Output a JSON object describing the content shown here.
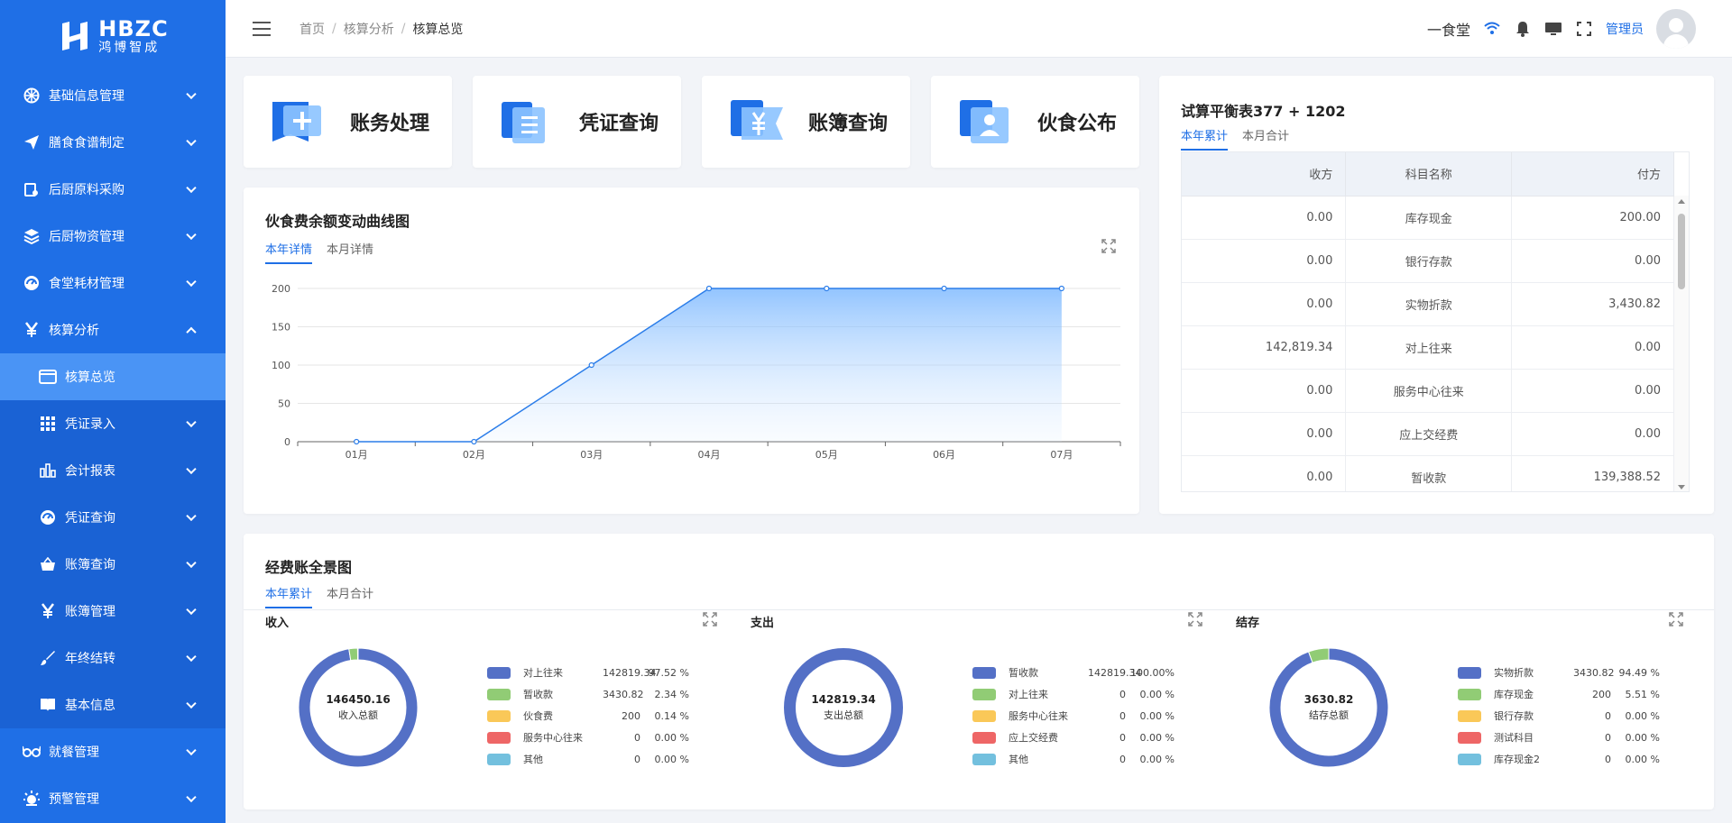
{
  "brand": {
    "name": "HBZC",
    "sub": "鸿博智成"
  },
  "header": {
    "breadcrumb": [
      "首页",
      "核算分析",
      "核算总览"
    ],
    "canteen": "一食堂",
    "admin": "管理员"
  },
  "sidebar": {
    "items": [
      {
        "label": "基础信息管理",
        "icon": "dashboard-icon"
      },
      {
        "label": "膳食食谱制定",
        "icon": "send-icon"
      },
      {
        "label": "后厨原料采购",
        "icon": "purchase-icon"
      },
      {
        "label": "后厨物资管理",
        "icon": "layers-icon"
      },
      {
        "label": "食堂耗材管理",
        "icon": "gauge-icon"
      },
      {
        "label": "核算分析",
        "icon": "yen-icon"
      }
    ],
    "sub_items": [
      {
        "label": "核算总览",
        "icon": "window-icon"
      },
      {
        "label": "凭证录入",
        "icon": "grid-icon"
      },
      {
        "label": "会计报表",
        "icon": "bar-chart-icon"
      },
      {
        "label": "凭证查询",
        "icon": "gauge-icon"
      },
      {
        "label": "账簿查询",
        "icon": "basket-icon"
      },
      {
        "label": "账簿管理",
        "icon": "yen-icon"
      },
      {
        "label": "年终结转",
        "icon": "brush-icon"
      },
      {
        "label": "基本信息",
        "icon": "book-icon"
      }
    ],
    "bottom_items": [
      {
        "label": "就餐管理",
        "icon": "glasses-icon"
      },
      {
        "label": "预警管理",
        "icon": "alarm-icon"
      }
    ]
  },
  "quick_cards": [
    {
      "label": "账务处理",
      "icon": "ledger-add-icon"
    },
    {
      "label": "凭证查询",
      "icon": "voucher-icon"
    },
    {
      "label": "账簿查询",
      "icon": "yen-book-icon"
    },
    {
      "label": "伙食公布",
      "icon": "notice-icon"
    }
  ],
  "line_panel": {
    "title": "伙食费余额变动曲线图",
    "tabs": [
      "本年详情",
      "本月详情"
    ]
  },
  "chart_data": {
    "type": "area",
    "x": [
      "01月",
      "02月",
      "03月",
      "04月",
      "05月",
      "06月",
      "07月"
    ],
    "values": [
      0,
      0,
      100,
      200,
      200,
      200,
      200
    ],
    "yticks": [
      0,
      50,
      100,
      150,
      200
    ],
    "ylim": [
      0,
      200
    ],
    "grid": true,
    "color": "#2b7de9"
  },
  "trial_balance": {
    "title": "试算平衡表377 + 1202",
    "tabs": [
      "本年累计",
      "本月合计"
    ],
    "headers": [
      "收方",
      "科目名称",
      "付方"
    ],
    "rows": [
      [
        "0.00",
        "库存现金",
        "200.00"
      ],
      [
        "0.00",
        "银行存款",
        "0.00"
      ],
      [
        "0.00",
        "实物折款",
        "3,430.82"
      ],
      [
        "142,819.34",
        "对上往来",
        "0.00"
      ],
      [
        "0.00",
        "服务中心往来",
        "0.00"
      ],
      [
        "0.00",
        "应上交经费",
        "0.00"
      ],
      [
        "0.00",
        "暂收款",
        "139,388.52"
      ]
    ]
  },
  "overview": {
    "title": "经费账全景图",
    "tabs": [
      "本年累计",
      "本月合计"
    ],
    "sections": [
      {
        "title": "收入",
        "total": "146450.16",
        "total_label": "收入总额",
        "legend": [
          {
            "name": "对上往来",
            "value": "142819.34",
            "pct": "97.52 %",
            "color": "#5470c6",
            "share": 97.52
          },
          {
            "name": "暂收款",
            "value": "3430.82",
            "pct": "2.34 %",
            "color": "#91cc75",
            "share": 2.34
          },
          {
            "name": "伙食费",
            "value": "200",
            "pct": "0.14 %",
            "color": "#fac858",
            "share": 0.14
          },
          {
            "name": "服务中心往来",
            "value": "0",
            "pct": "0.00 %",
            "color": "#ee6666",
            "share": 0
          },
          {
            "name": "其他",
            "value": "0",
            "pct": "0.00 %",
            "color": "#73c0de",
            "share": 0
          }
        ]
      },
      {
        "title": "支出",
        "total": "142819.34",
        "total_label": "支出总额",
        "legend": [
          {
            "name": "暂收款",
            "value": "142819.34",
            "pct": "100.00%",
            "color": "#5470c6",
            "share": 100
          },
          {
            "name": "对上往来",
            "value": "0",
            "pct": "0.00 %",
            "color": "#91cc75",
            "share": 0
          },
          {
            "name": "服务中心往来",
            "value": "0",
            "pct": "0.00 %",
            "color": "#fac858",
            "share": 0
          },
          {
            "name": "应上交经费",
            "value": "0",
            "pct": "0.00 %",
            "color": "#ee6666",
            "share": 0
          },
          {
            "name": "其他",
            "value": "0",
            "pct": "0.00 %",
            "color": "#73c0de",
            "share": 0
          }
        ]
      },
      {
        "title": "结存",
        "total": "3630.82",
        "total_label": "结存总额",
        "legend": [
          {
            "name": "实物折款",
            "value": "3430.82",
            "pct": "94.49 %",
            "color": "#5470c6",
            "share": 94.49
          },
          {
            "name": "库存现金",
            "value": "200",
            "pct": "5.51 %",
            "color": "#91cc75",
            "share": 5.51
          },
          {
            "name": "银行存款",
            "value": "0",
            "pct": "0.00 %",
            "color": "#fac858",
            "share": 0
          },
          {
            "name": "测试科目",
            "value": "0",
            "pct": "0.00 %",
            "color": "#ee6666",
            "share": 0
          },
          {
            "name": "库存现金2",
            "value": "0",
            "pct": "0.00 %",
            "color": "#73c0de",
            "share": 0
          }
        ]
      }
    ]
  }
}
